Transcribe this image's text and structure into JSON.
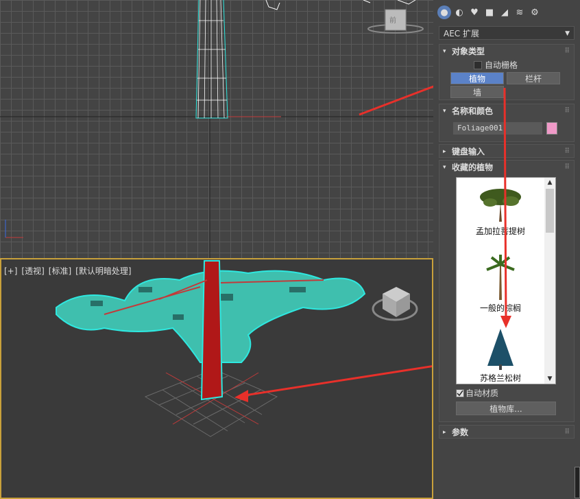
{
  "viewport_top": {
    "label": ""
  },
  "viewport_persp": {
    "labels": [
      "[+]",
      "[透视]",
      "[标准]",
      "[默认明暗处理]"
    ]
  },
  "panel": {
    "tabs": [
      "create-icon",
      "modify-icon",
      "hierarchy-icon",
      "motion-icon",
      "display-icon",
      "utilities-icon",
      "settings-icon"
    ],
    "dropdown": {
      "value": "AEC 扩展"
    },
    "object_type": {
      "title": "对象类型",
      "auto_grid": "自动栅格",
      "buttons": [
        "植物",
        "栏杆",
        "墙"
      ]
    },
    "name_color": {
      "title": "名称和颜色",
      "name_value": "Foliage001",
      "color": "#f09ac8"
    },
    "keyboard_input": {
      "title": "键盘输入"
    },
    "favorites": {
      "title": "收藏的植物",
      "plants": [
        "孟加拉菩提树",
        "一般的棕榈",
        "苏格兰松树"
      ],
      "auto_material": "自动材质",
      "library_button": "植物库..."
    },
    "params": {
      "title": "参数"
    }
  },
  "colors": {
    "accent": "#5b82c8",
    "selection": "#2ee8e0",
    "annotation_arrow": "#e8302a",
    "viewport_active_border": "#c9a13b"
  }
}
